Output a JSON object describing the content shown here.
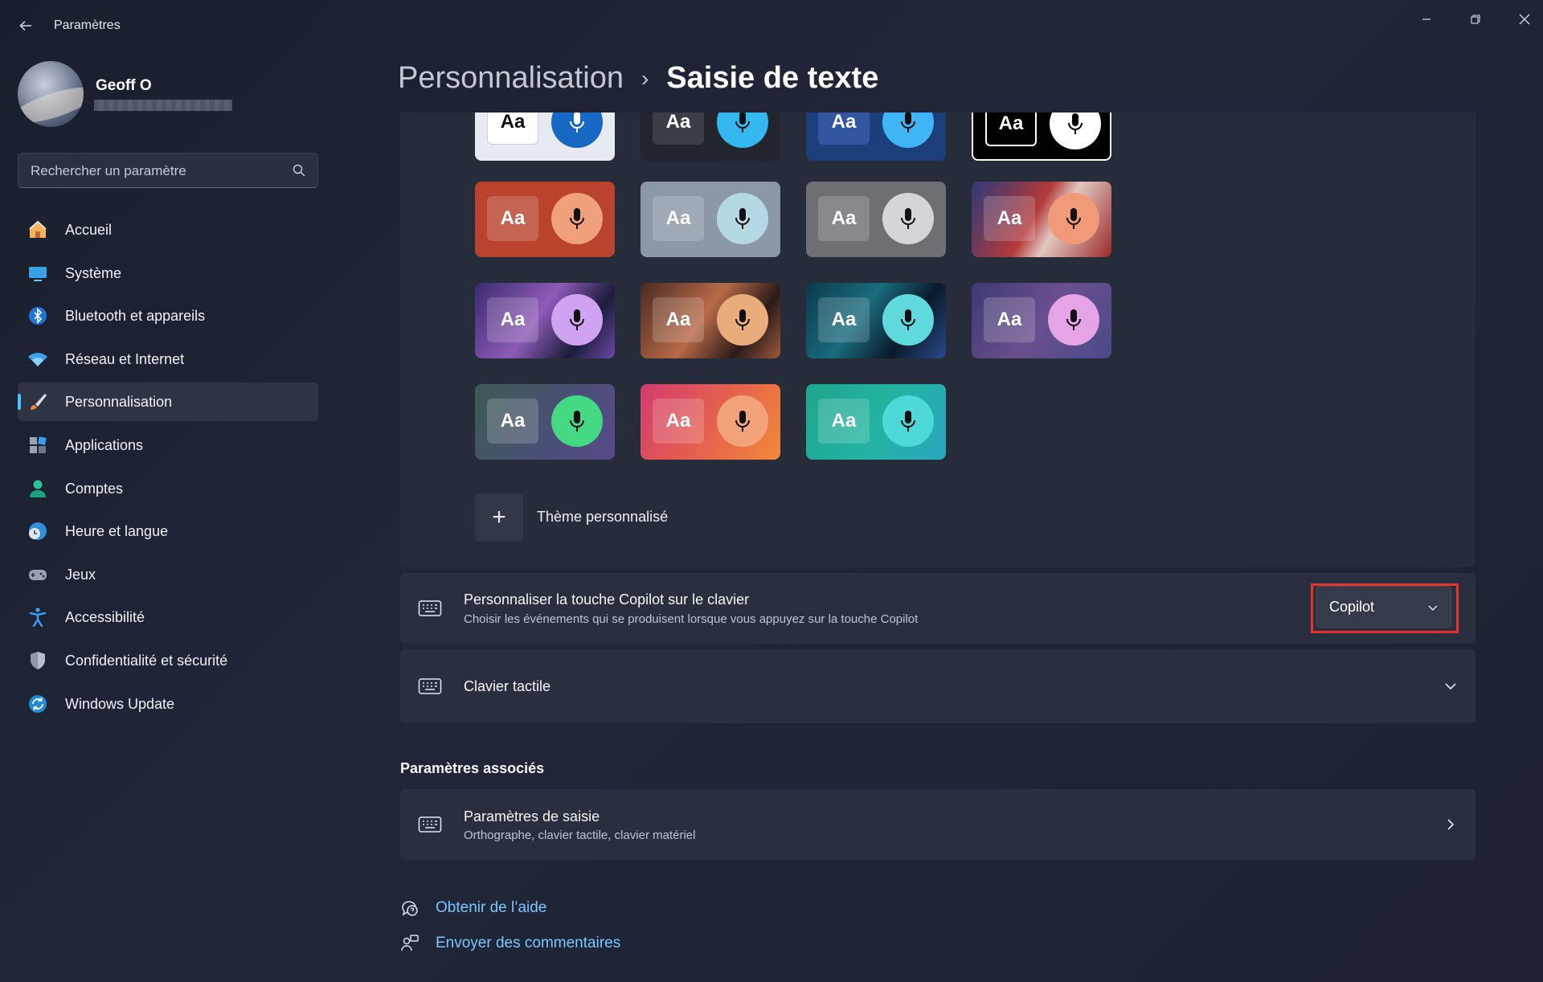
{
  "window": {
    "title": "Paramètres"
  },
  "profile": {
    "name": "Geoff O"
  },
  "search": {
    "placeholder": "Rechercher un paramètre"
  },
  "nav": {
    "items": [
      {
        "label": "Accueil",
        "icon": "home-icon"
      },
      {
        "label": "Système",
        "icon": "system-icon"
      },
      {
        "label": "Bluetooth et appareils",
        "icon": "bluetooth-icon"
      },
      {
        "label": "Réseau et Internet",
        "icon": "wifi-icon"
      },
      {
        "label": "Personnalisation",
        "icon": "brush-icon",
        "active": true
      },
      {
        "label": "Applications",
        "icon": "apps-icon"
      },
      {
        "label": "Comptes",
        "icon": "account-icon"
      },
      {
        "label": "Heure et langue",
        "icon": "time-language-icon"
      },
      {
        "label": "Jeux",
        "icon": "gamepad-icon"
      },
      {
        "label": "Accessibilité",
        "icon": "accessibility-icon"
      },
      {
        "label": "Confidentialité et sécurité",
        "icon": "shield-icon"
      },
      {
        "label": "Windows Update",
        "icon": "update-icon"
      }
    ]
  },
  "breadcrumb": {
    "parent": "Personnalisation",
    "current": "Saisie de texte"
  },
  "themes": {
    "tile_text": "Aa",
    "custom_label": "Thème personnalisé"
  },
  "copilot_key": {
    "title": "Personnaliser la touche Copilot sur le clavier",
    "description": "Choisir les événements qui se produisent lorsque vous appuyez sur la touche Copilot",
    "selected": "Copilot"
  },
  "touch_keyboard": {
    "title": "Clavier tactile"
  },
  "related": {
    "heading": "Paramètres associés",
    "title": "Paramètres de saisie",
    "description": "Orthographe, clavier tactile, clavier matériel"
  },
  "links": {
    "help": "Obtenir de l’aide",
    "feedback": "Envoyer des commentaires"
  },
  "colors": {
    "accent": "#4cc2ff",
    "highlight": "#e3352b",
    "link": "#79c7ff"
  }
}
